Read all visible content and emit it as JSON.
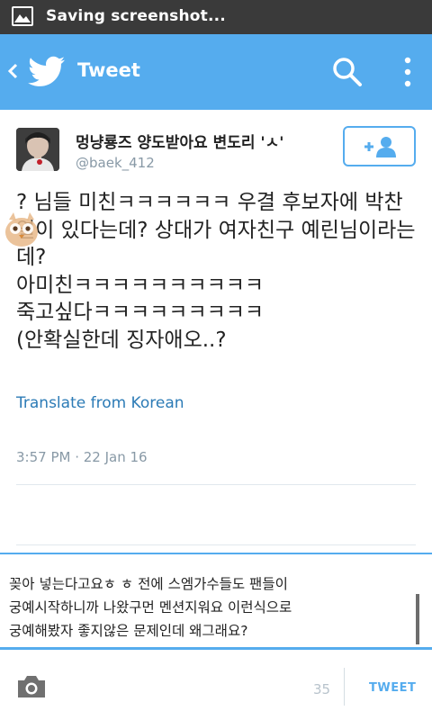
{
  "status_bar": {
    "text": "Saving screenshot..."
  },
  "app_bar": {
    "title": "Tweet"
  },
  "tweet": {
    "user_name": "멍냥룡즈 양도받아요 변도리 'ㅅ'",
    "handle": "@baek_412",
    "text": "? 님들 미친ㅋㅋㅋㅋㅋㅋ 우결 후보자에 박찬열이 있다는데? 상대가 여자친구 예린님이라는데?\n아미친ㅋㅋㅋㅋㅋㅋㅋㅋㅋㅋ\n죽고싶다ㅋㅋㅋㅋㅋㅋㅋㅋㅋ\n(안확실한데 징자애오..?",
    "translate_label": "Translate from Korean",
    "timestamp": "3:57 PM · 22 Jan 16"
  },
  "reply": {
    "text": "꽂아 넣는다고요ㅎ ㅎ 전에 스엠가수들도 팬들이\n궁예시작하니까 나왔구먼 멘션지워요 이런식으로\n궁예해봤자 좋지않은 문제인데 왜그래요?",
    "char_count": "35",
    "tweet_button_label": "TWEET"
  },
  "colors": {
    "brand": "#55acee",
    "status_bar": "#3a3a3a"
  },
  "icons": [
    "gallery-icon",
    "back-icon",
    "twitter-bird-icon",
    "search-icon",
    "more-vert-icon",
    "follow-user-icon",
    "camera-icon"
  ]
}
